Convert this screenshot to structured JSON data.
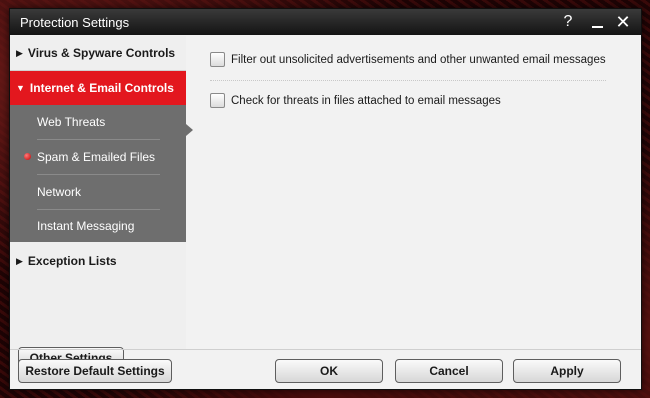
{
  "window": {
    "title": "Protection Settings",
    "help_glyph": "?",
    "close_glyph": "✕"
  },
  "sidebar": {
    "sections": [
      {
        "label": "Virus & Spyware Controls",
        "expanded": false
      },
      {
        "label": "Internet & Email Controls",
        "expanded": true
      },
      {
        "label": "Exception Lists",
        "expanded": false
      }
    ],
    "subitems": [
      {
        "label": "Web Threats",
        "selected": false
      },
      {
        "label": "Spam & Emailed Files",
        "selected": true
      },
      {
        "label": "Network",
        "selected": false
      },
      {
        "label": "Instant Messaging",
        "selected": false
      }
    ],
    "other_settings_label": "Other Settings"
  },
  "content": {
    "options": [
      {
        "label": "Filter out unsolicited advertisements and other unwanted email messages",
        "checked": false
      },
      {
        "label": "Check for threats in files attached to email messages",
        "checked": false
      }
    ]
  },
  "footer": {
    "restore_label": "Restore Default Settings",
    "ok_label": "OK",
    "cancel_label": "Cancel",
    "apply_label": "Apply"
  },
  "colors": {
    "accent": "#e3171e",
    "subnav_bg": "#6e6e6e",
    "titlebar_bg": "#1e1e1e"
  }
}
